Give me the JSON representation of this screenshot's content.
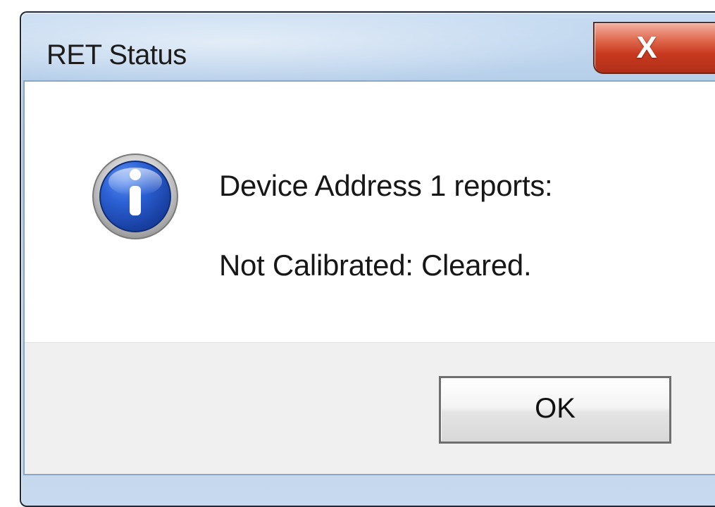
{
  "window": {
    "title": "RET Status",
    "close_button_glyph": "X"
  },
  "message": {
    "icon": "info-icon",
    "line_1": "Device Address 1 reports:",
    "line_2": "Not Calibrated:  Cleared."
  },
  "buttons": {
    "ok_label": "OK"
  },
  "colors": {
    "title_bar": "#b6cfea",
    "close_button": "#c8391f",
    "content_background": "#ffffff",
    "footer_background": "#f0f0f0"
  }
}
